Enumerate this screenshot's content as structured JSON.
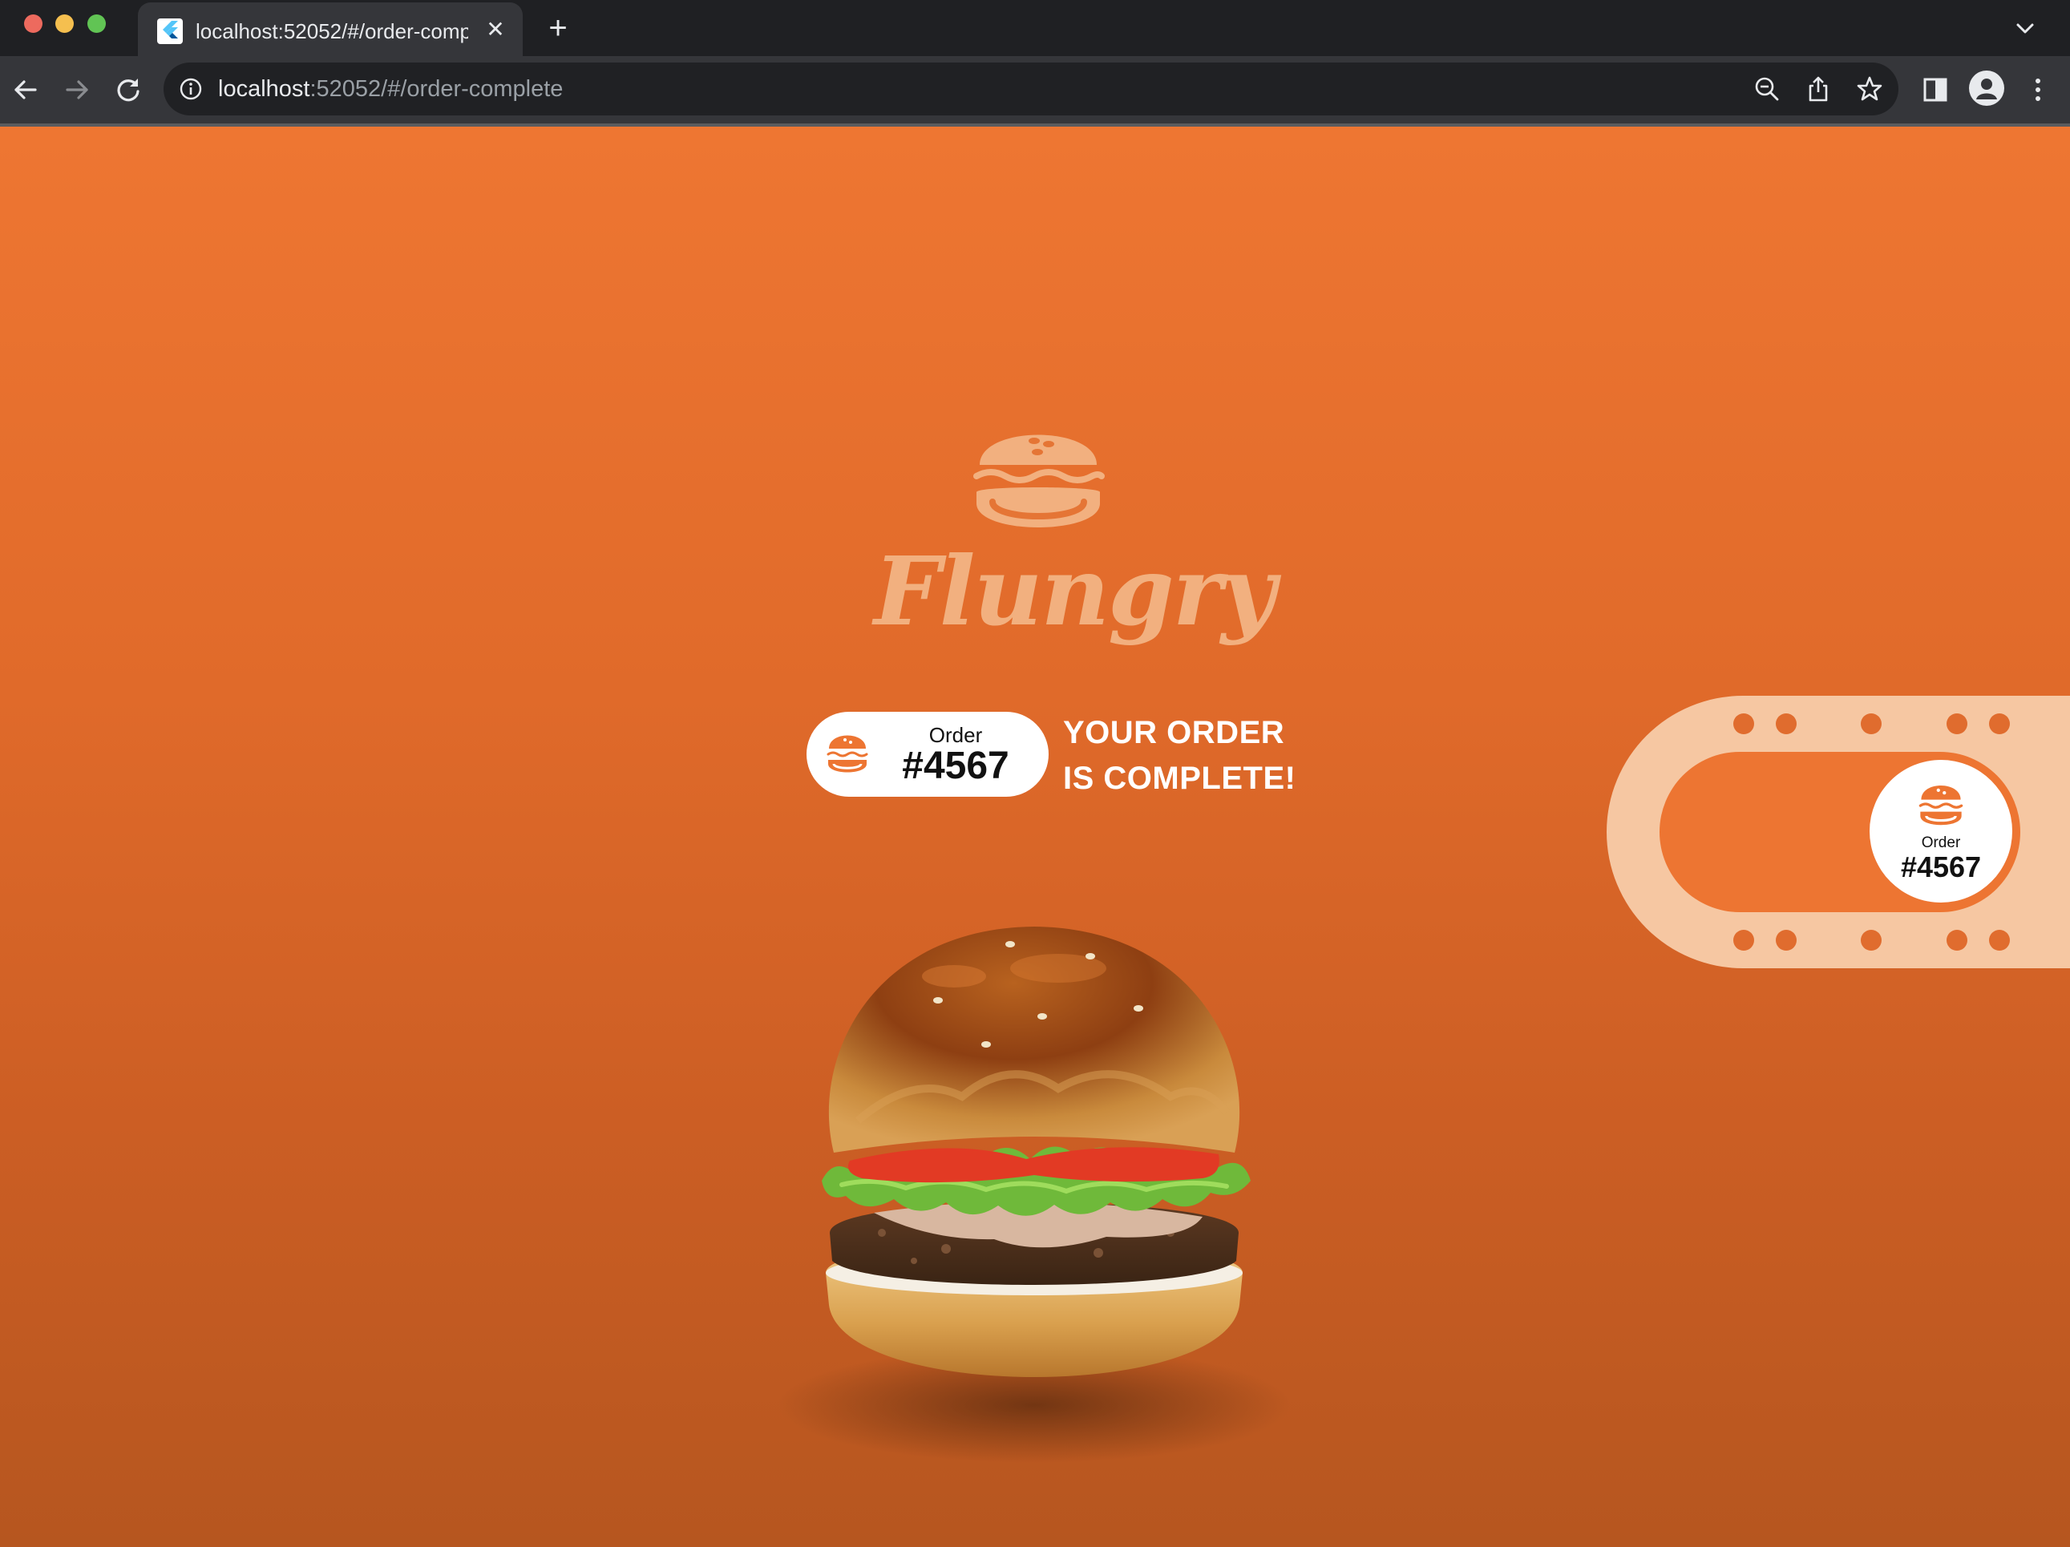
{
  "browser": {
    "tab_title": "localhost:52052/#/order-complete",
    "tab_close_glyph": "✕",
    "new_tab_glyph": "+",
    "url_host": "localhost",
    "url_rest": ":52052/#/order-complete",
    "icons": {
      "favicon": "flutter-favicon-icon",
      "back": "back-arrow-icon",
      "forward": "forward-arrow-icon",
      "reload": "reload-icon",
      "site_info": "info-icon",
      "zoom": "zoom-out-icon",
      "share": "share-icon",
      "bookmark": "star-icon",
      "side_panel": "side-panel-icon",
      "profile": "profile-icon",
      "menu": "kebab-menu-icon",
      "tab_search": "chevron-down-icon"
    }
  },
  "page": {
    "brand_name": "Flungry",
    "order_label": "Order",
    "order_number": "#4567",
    "complete_line1": "YOUR ORDER",
    "complete_line2": "IS COMPLETE!",
    "tracker": {
      "order_label": "Order",
      "order_number": "#4567"
    },
    "colors": {
      "background_top": "#ee7632",
      "background_bottom": "#b6561f",
      "logo": "#f2b07f",
      "tracker_track": "#f6c7a2",
      "pill_bg": "#ffffff"
    }
  }
}
